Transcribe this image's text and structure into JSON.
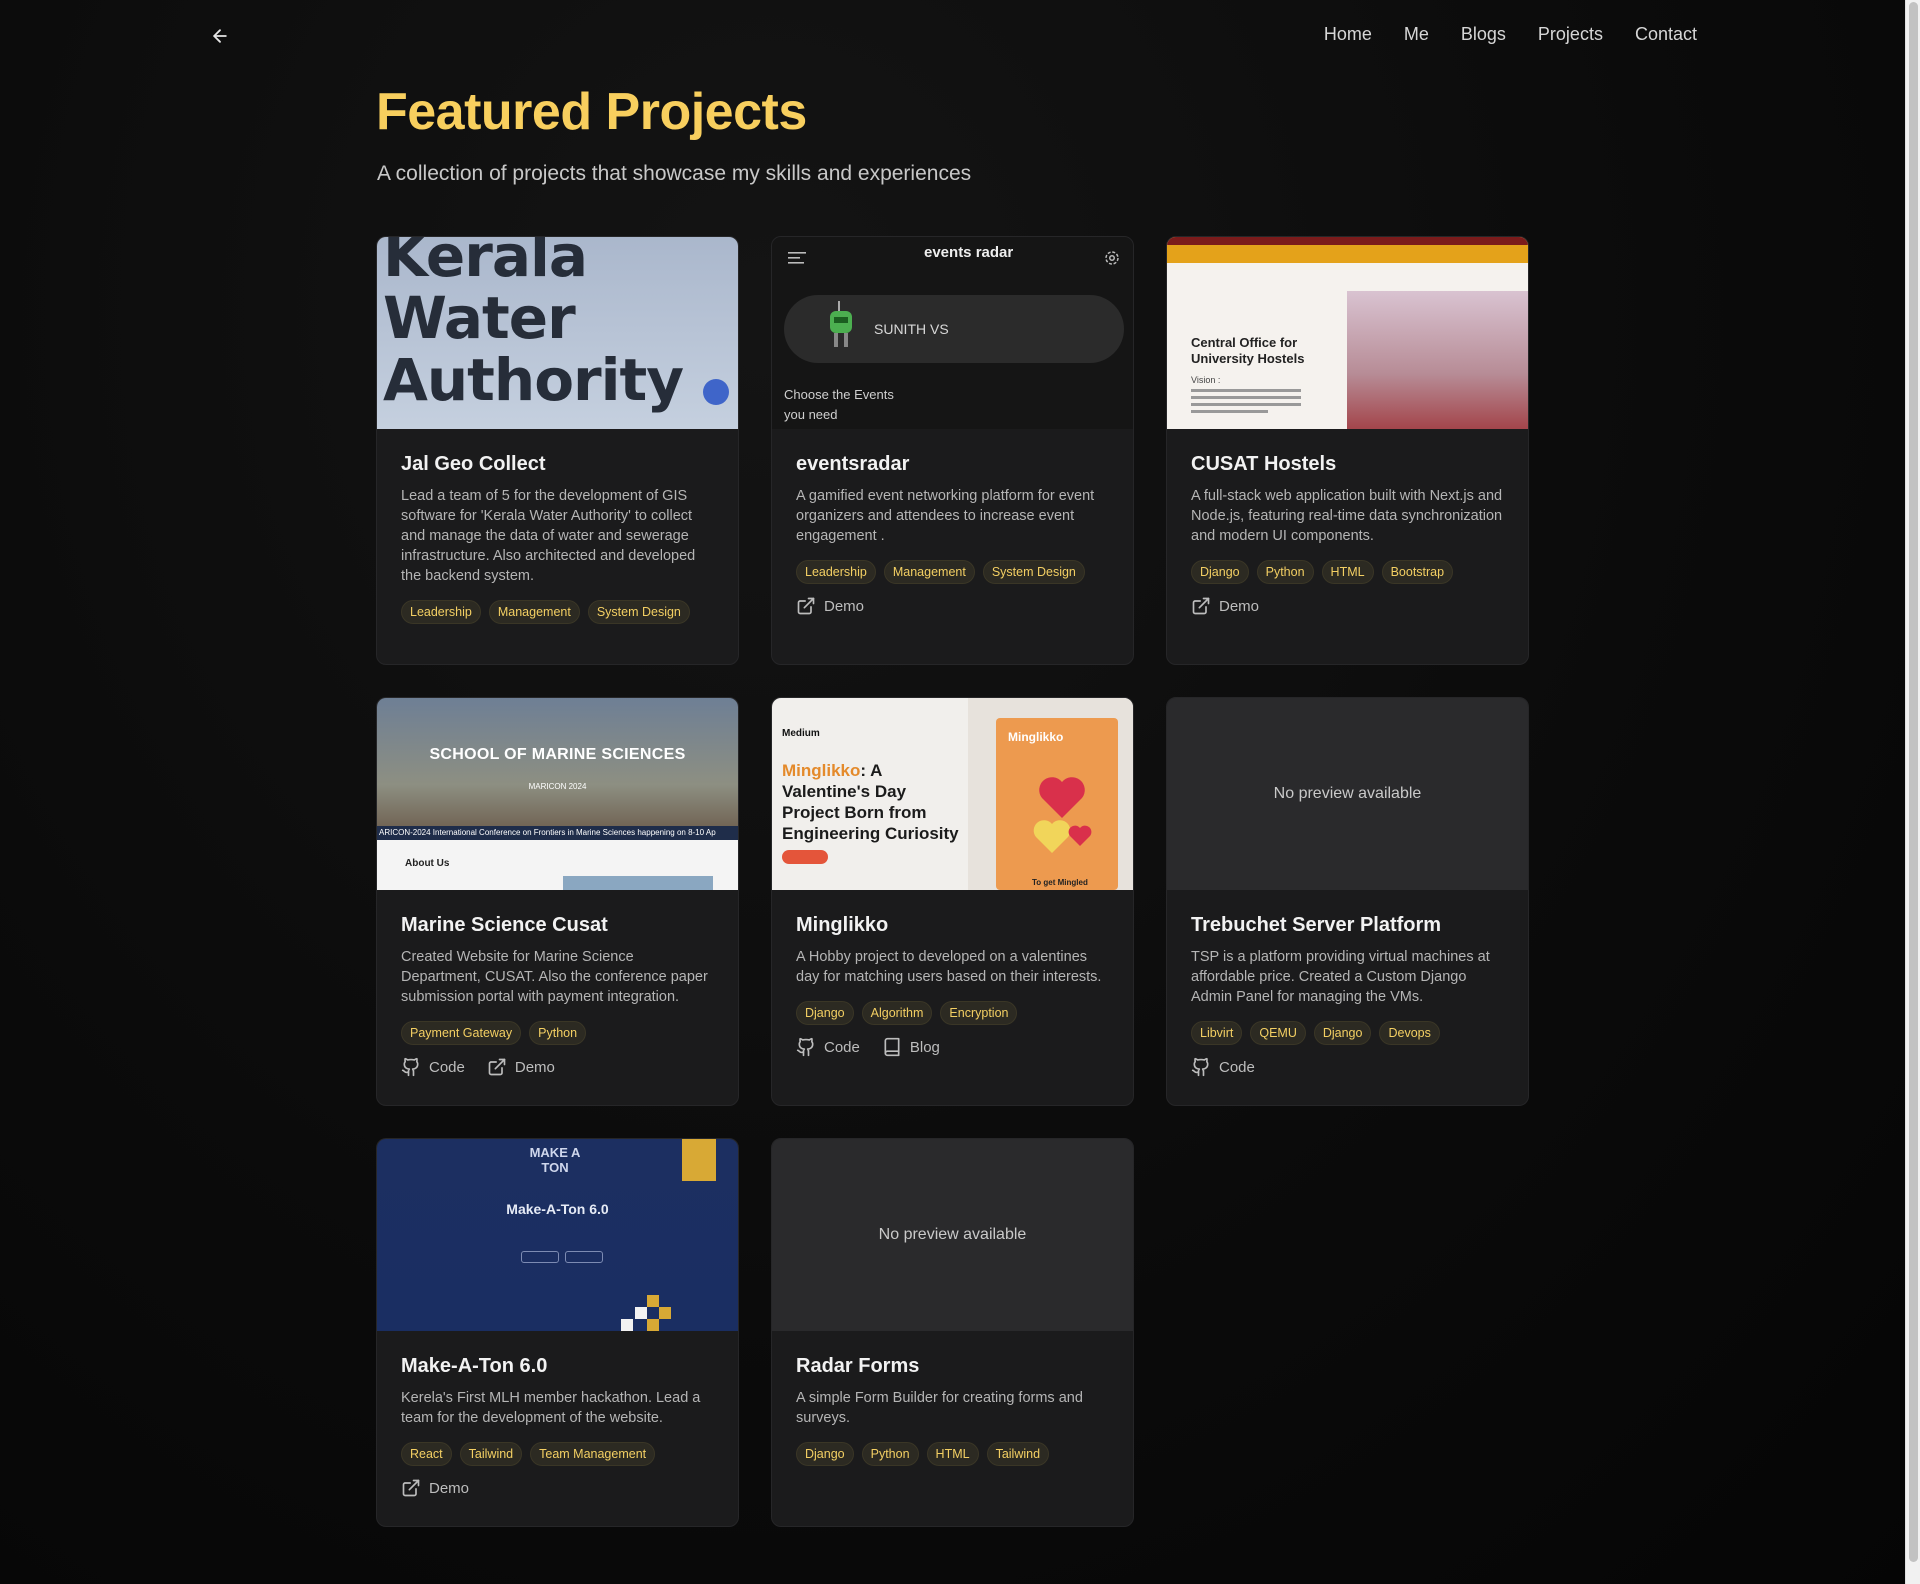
{
  "nav": {
    "back_label": "",
    "items": [
      "Home",
      "Me",
      "Blogs",
      "Projects",
      "Contact"
    ]
  },
  "page": {
    "title": "Featured Projects",
    "subtitle": "A collection of projects that showcase my skills and experiences"
  },
  "colors": {
    "accent": "#f8cf5e",
    "card_bg": "#1b1b1c",
    "tag_bg": "#2c2a22",
    "tag_text": "#f3cf63"
  },
  "preview_texts": {
    "kwa": "Kerala Water Authority",
    "events_logo": "events radar",
    "events_user": "SUNITH VS",
    "events_choose": "Choose the Events you need",
    "cusat_title": "Central Office for University Hostels",
    "cusat_vision": "Vision :",
    "marine_title": "SCHOOL OF MARINE SCIENCES",
    "marine_sub": "MARICON 2024",
    "marine_strip": "ARICON-2024 International Conference on Frontiers in Marine Sciences happening on 8-10 Ap",
    "marine_about": "About Us",
    "ming_medium": "Medium",
    "ming_headline_hl": "Minglikko",
    "ming_headline_rest": ": A Valentine's Day Project Born from Engineering Curiosity",
    "ming_book": "Minglikko",
    "ming_footer": "To get Mingled",
    "mat_logo": "MAKE A TON",
    "mat_name": "Make-A-Ton 6.0",
    "no_preview": "No preview available"
  },
  "projects": [
    {
      "title": "Jal Geo Collect",
      "description": "Lead a team of 5 for the development of GIS software for 'Kerala Water Authority' to collect and manage the data of water and sewerage infrastructure. Also architected and developed the backend system.",
      "tags": [
        "Leadership",
        "Management",
        "System Design"
      ],
      "links": []
    },
    {
      "title": "eventsradar",
      "description": "A gamified event networking platform for event organizers and attendees to increase event engagement .",
      "tags": [
        "Leadership",
        "Management",
        "System Design"
      ],
      "links": [
        "Demo"
      ]
    },
    {
      "title": "CUSAT Hostels",
      "description": "A full-stack web application built with Next.js and Node.js, featuring real-time data synchronization and modern UI components.",
      "tags": [
        "Django",
        "Python",
        "HTML",
        "Bootstrap"
      ],
      "links": [
        "Demo"
      ]
    },
    {
      "title": "Marine Science Cusat",
      "description": "Created Website for Marine Science Department, CUSAT. Also the conference paper submission portal with payment integration.",
      "tags": [
        "Payment Gateway",
        "Python"
      ],
      "links": [
        "Code",
        "Demo"
      ]
    },
    {
      "title": "Minglikko",
      "description": "A Hobby project to developed on a valentines day for matching users based on their interests.",
      "tags": [
        "Django",
        "Algorithm",
        "Encryption"
      ],
      "links": [
        "Code",
        "Blog"
      ]
    },
    {
      "title": "Trebuchet Server Platform",
      "description": "TSP is a platform providing virtual machines at affordable price. Created a Custom Django Admin Panel for managing the VMs.",
      "tags": [
        "Libvirt",
        "QEMU",
        "Django",
        "Devops"
      ],
      "links": [
        "Code"
      ]
    },
    {
      "title": "Make-A-Ton 6.0",
      "description": "Kerela's First MLH member hackathon. Lead a team for the development of the website.",
      "tags": [
        "React",
        "Tailwind",
        "Team Management"
      ],
      "links": [
        "Demo"
      ]
    },
    {
      "title": "Radar Forms",
      "description": "A simple Form Builder for creating forms and surveys.",
      "tags": [
        "Django",
        "Python",
        "HTML",
        "Tailwind"
      ],
      "links": []
    }
  ]
}
